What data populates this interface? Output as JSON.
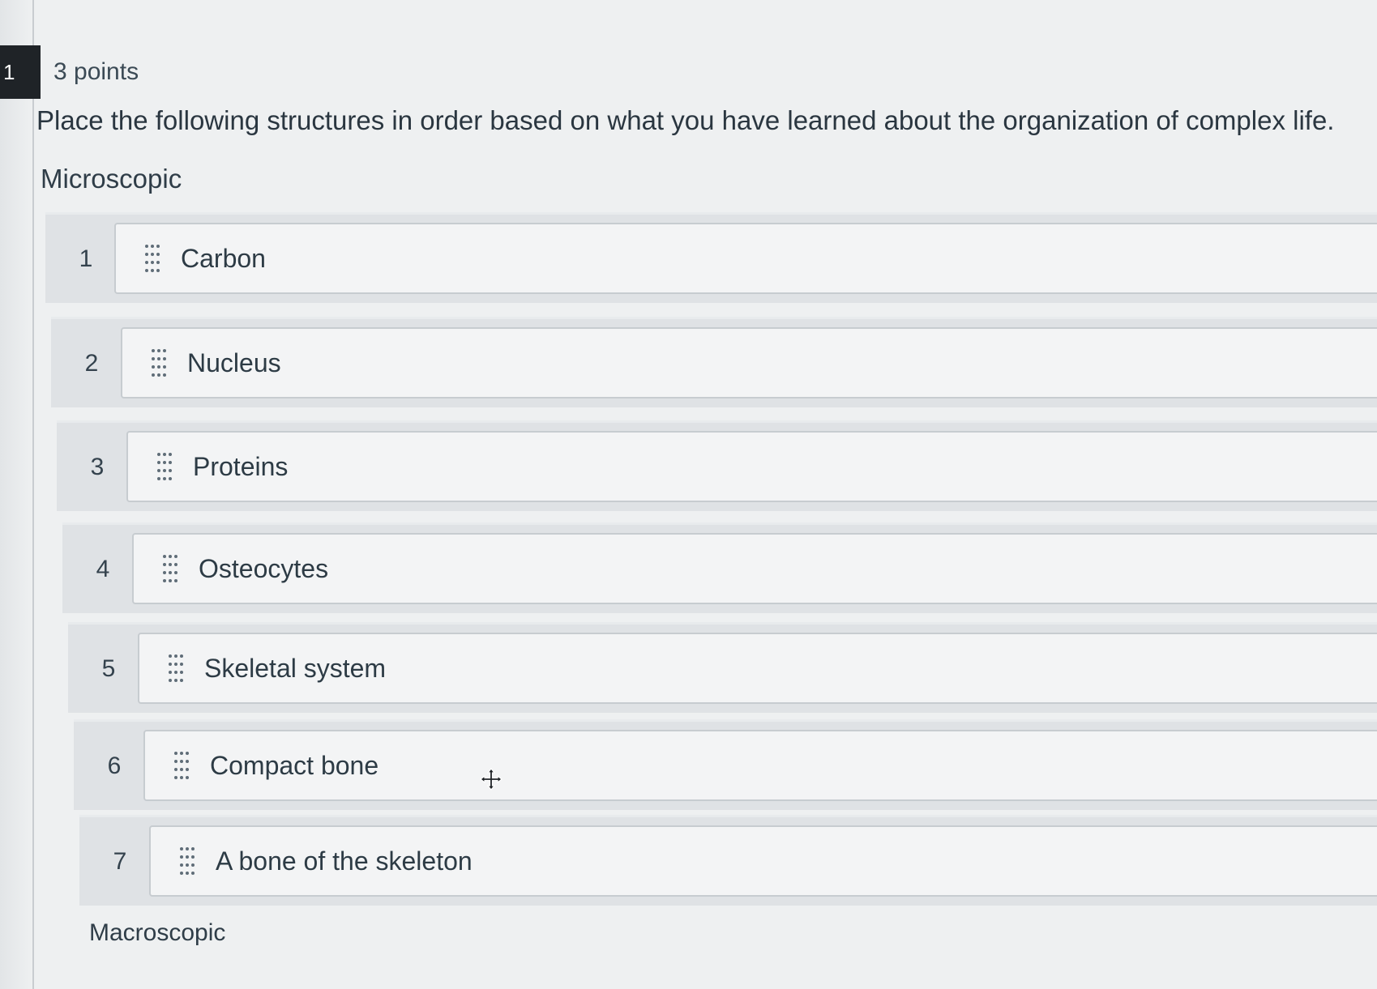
{
  "question": {
    "number_badge": "1",
    "points": "3 points",
    "prompt": "Place the following structures in order based on what you have learned about the organization of complex life.",
    "top_label": "Microscopic",
    "bottom_label": "Macroscopic"
  },
  "ordering": {
    "items": [
      {
        "index": "1",
        "label": "Carbon"
      },
      {
        "index": "2",
        "label": "Nucleus"
      },
      {
        "index": "3",
        "label": "Proteins"
      },
      {
        "index": "4",
        "label": "Osteocytes"
      },
      {
        "index": "5",
        "label": "Skeletal system"
      },
      {
        "index": "6",
        "label": "Compact bone"
      },
      {
        "index": "7",
        "label": "A bone of the skeleton"
      }
    ]
  },
  "icons": {
    "drag_handle": "drag-handle-icon",
    "cursor": "move-cursor-icon"
  },
  "colors": {
    "badge_bg": "#1f2327",
    "row_bg": "#dfe2e5",
    "card_bg": "#f3f4f5",
    "text": "#2d3b45"
  }
}
